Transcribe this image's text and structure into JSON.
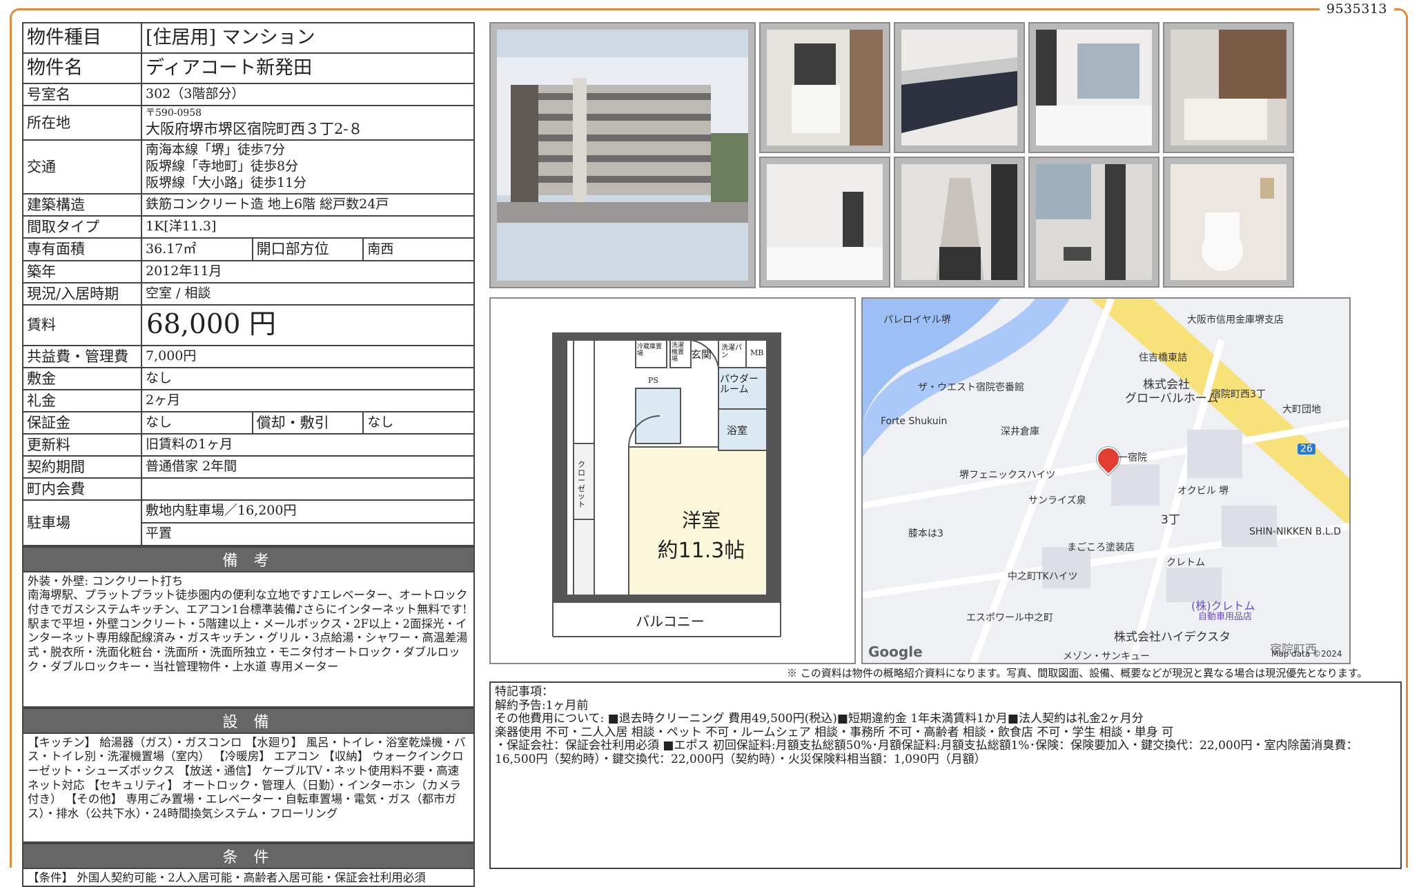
{
  "doc_id": "9535313",
  "table": {
    "type_label": "物件種目",
    "type_value": "[住居用] マンション",
    "name_label": "物件名",
    "name_value": "ディアコート新発田",
    "room_label": "号室名",
    "room_value": "302（3階部分）",
    "addr_label": "所在地",
    "addr_zip": "〒590-0958",
    "addr_value": "大阪府堺市堺区宿院町西３丁2-８",
    "traffic_label": "交通",
    "traffic_lines": [
      "南海本線「堺」徒歩7分",
      "阪堺線「寺地町」徒歩8分",
      "阪堺線「大小路」徒歩11分"
    ],
    "structure_label": "建築構造",
    "structure_value": "鉄筋コンクリート造 地上6階 総戸数24戸",
    "layout_label": "間取タイプ",
    "layout_value": "1K[洋11.3]",
    "area_label": "専有面積",
    "area_value": "36.17㎡",
    "direction_label": "開口部方位",
    "direction_value": "南西",
    "built_label": "築年",
    "built_value": "2012年11月",
    "status_label": "現況/入居時期",
    "status_value": "空室 / 相談",
    "rent_label": "賃料",
    "rent_value": "68,000 円",
    "fee_label": "共益費・管理費",
    "fee_value": "7,000円",
    "deposit_label": "敷金",
    "deposit_value": "なし",
    "keymoney_label": "礼金",
    "keymoney_value": "2ヶ月",
    "security_label": "保証金",
    "security_value": "なし",
    "amort_label": "償却・敷引",
    "amort_value": "なし",
    "renewal_label": "更新料",
    "renewal_value": "旧賃料の1ヶ月",
    "contract_label": "契約期間",
    "contract_value": "普通借家 2年間",
    "town_label": "町内会費",
    "town_value": "",
    "parking_label": "駐車場",
    "parking_value1": "敷地内駐車場／16,200円",
    "parking_value2": "平置"
  },
  "remarks": {
    "title": "備 考",
    "lines": [
      "外装・外壁: コンクリート打ち",
      "南海堺駅、プラットプラット徒歩圏内の便利な立地です♪エレベーター、オートロック付きでガスシステムキッチン、エアコン1台標準装備♪さらにインターネット無料です!",
      "駅まで平坦・外壁コンクリート・5階建以上・メールボックス・2F以上・2面採光・インターネット専用線配線済み・ガスキッチン・グリル・3点給湯・シャワー・高温差湯式・脱衣所・洗面化粧台・洗面所・洗面所独立・モニタ付オートロック・ダブルロック・ダブルロックキー・当社管理物件・上水道 専用メーター"
    ]
  },
  "equipment": {
    "title": "設 備",
    "text": "【キッチン】 給湯器（ガス）・ガスコンロ 【水廻り】 風呂・トイレ・浴室乾燥機・バス・トイレ別・洗濯機置場（室内） 【冷暖房】 エアコン 【収納】 ウォークインクローゼット・シューズボックス 【放送・通信】 ケーブルTV・ネット使用料不要・高速ネット対応 【セキュリティ】 オートロック・管理人（日勤）・インターホン（カメラ付き） 【その他】 専用ごみ置場・エレベーター・自転車置場・電気・ガス（都市ガス）・排水（公共下水）・24時間換気システム・フローリング"
  },
  "conditions": {
    "title": "条 件",
    "text": "【条件】 外国人契約可能・2人入居可能・高齢者入居可能・保証会社利用必須"
  },
  "floorplan": {
    "room_name": "洋室",
    "room_size": "約11.3帖",
    "balcony": "バルコニー",
    "entrance": "玄関",
    "powder": "パウダールーム",
    "bath": "浴室",
    "closet": "クローゼット",
    "fridge": "冷蔵庫置場",
    "washer": "洗濯機置場",
    "pan": "洗濯パン",
    "mb": "MB",
    "ps": "PS"
  },
  "map": {
    "labels": [
      "パレロイヤル堺",
      "大阪市信用金庫堺支店",
      "住吉橋東詰",
      "ザ・ウエスト宿院壱番館",
      "株式会社",
      "グローバルホーム",
      "宿院町西3丁",
      "大町団地",
      "Forte Shukuin",
      "深井倉庫",
      "一宿院",
      "26",
      "堺フェニックスハイツ",
      "オクビル 堺",
      "サンライズ泉",
      "3丁",
      "膝本は3",
      "まごころ塗装店",
      "SHIN-NIKKEN B.L.D",
      "クレトム",
      "中之町TKハイツ",
      "(株)クレトム",
      "自動車用品店",
      "エスポワール中之町",
      "株式会社ハイデクスタ",
      "メゾン・サンキュー",
      "宿院町西",
      "Map data ©2024",
      "Google"
    ]
  },
  "disclaimer": "※ この資料は物件の概略紹介資料になります。写真、間取図面、設備、概要などが現況と異なる場合は現況優先となります。",
  "special": {
    "lines": [
      "特記事項：",
      "解約予告:1ヶ月前",
      "その他費用について: ■退去時クリーニング 費用49,500円(税込)■短期違約金 1年未満賃料1か月■法人契約は礼金2ヶ月分",
      "楽器使用 不可・二人入居 相談・ペット 不可・ルームシェア 相談・事務所 不可・高齢者 相談・飲食店 不可・学生 相談・単身 可",
      "・保証会社：保証会社利用必須 ■エポス 初回保証料:月額支払総額50%･月額保証料:月額支払総額1%･保険：保険要加入・鍵交換代：22,000円・室内除菌消臭費：16,500円（契約時）・鍵交換代：22,000円（契約時）・火災保険料相当額：1,090円（月額）"
    ]
  }
}
